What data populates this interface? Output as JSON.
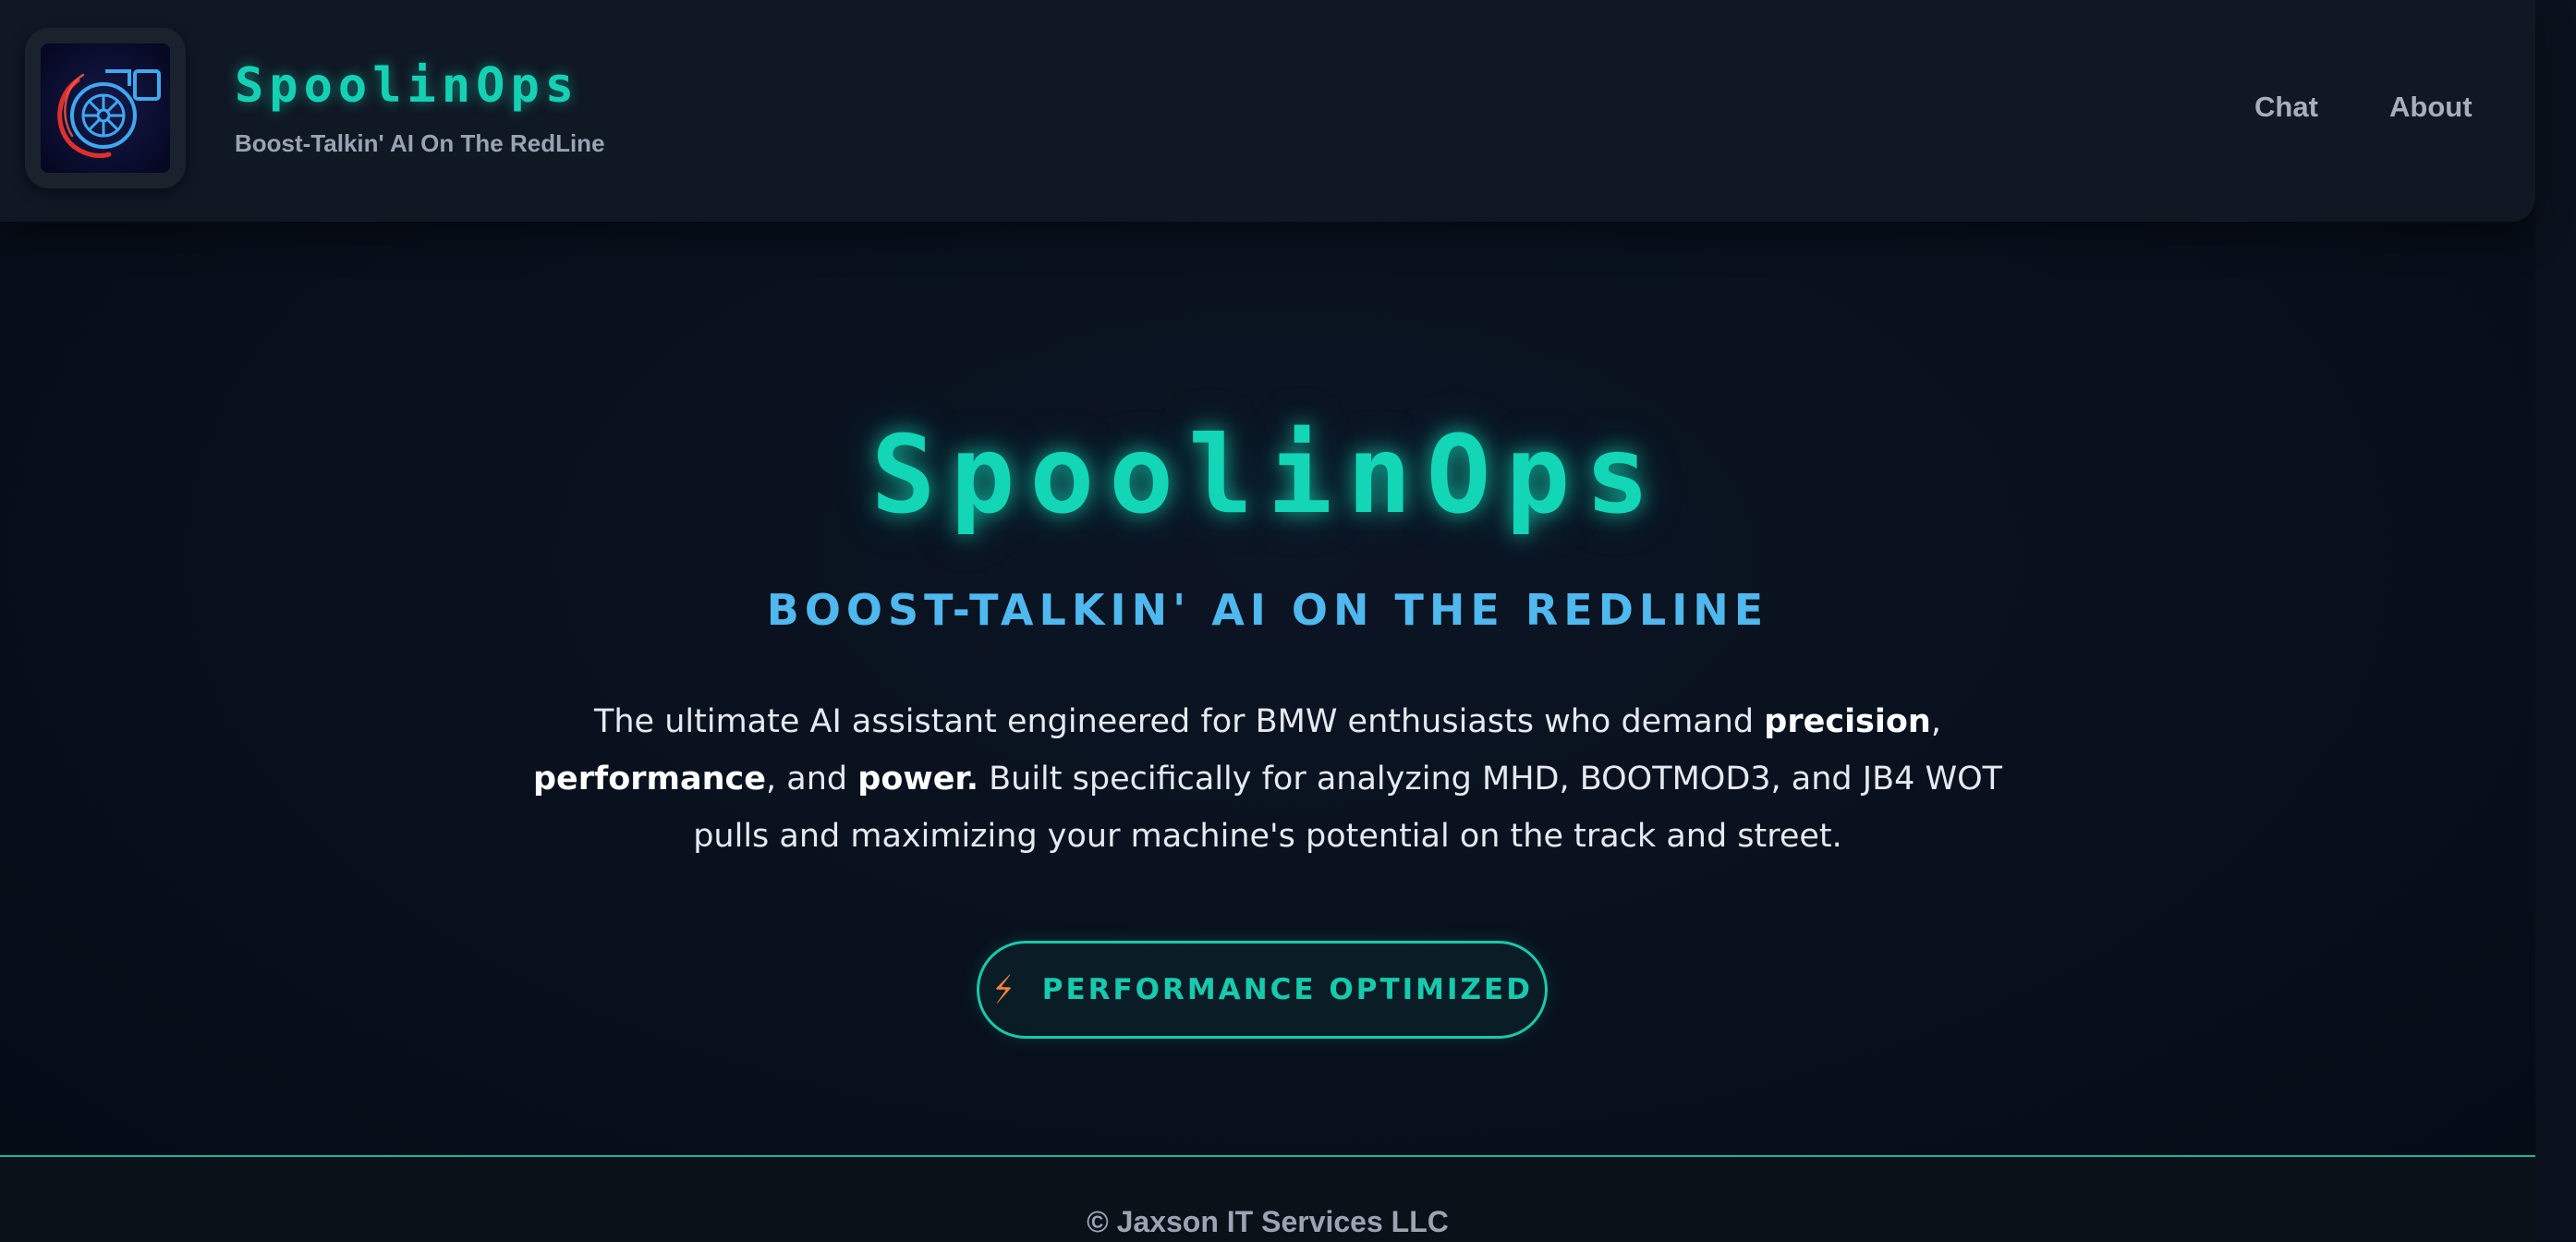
{
  "header": {
    "brand_title": "SpoolinOps",
    "brand_tagline": "Boost-Talkin' AI On The RedLine",
    "nav": {
      "chat": "Chat",
      "about": "About"
    },
    "logo_icon": "turbo-logo-icon"
  },
  "hero": {
    "title": "SpoolinOps",
    "subtitle": "BOOST-TALKIN' AI ON THE REDLINE",
    "description": {
      "part1": "The ultimate AI assistant engineered for BMW enthusiasts who demand ",
      "bold1": "precision",
      "part2": ", ",
      "bold2": "performance",
      "part3": ", and ",
      "bold3": "power.",
      "part4": " Built specifically for analyzing MHD, BOOTMOD3, and JB4 WOT pulls and maximizing your machine's potential on the track and street."
    },
    "badge_icon": "lightning-bolt-icon",
    "badge_label": "PERFORMANCE OPTIMIZED"
  },
  "footer": {
    "copyright": "© Jaxson IT Services LLC"
  },
  "colors": {
    "accent_teal": "#15d1b4",
    "accent_blue": "#4fb8ee",
    "bolt_orange": "#f2823a",
    "background": "#070d18"
  }
}
